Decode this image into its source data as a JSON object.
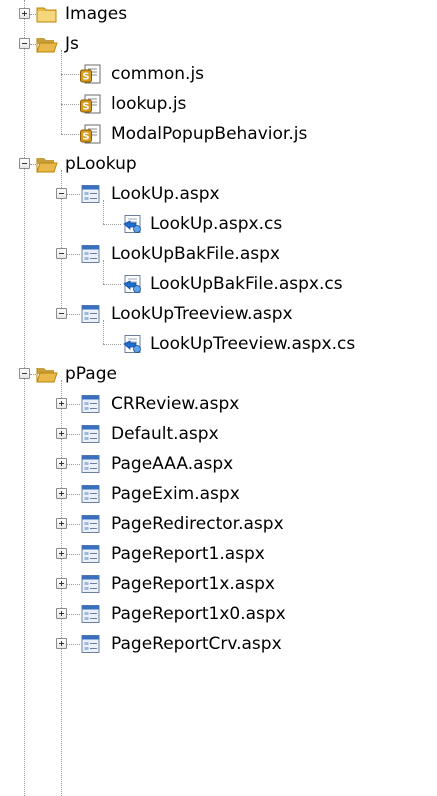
{
  "tree": {
    "rows": [
      {
        "label": "Images",
        "level": 0,
        "icon": "folder-closed",
        "toggle": "plus",
        "last": false
      },
      {
        "label": "Js",
        "level": 0,
        "icon": "folder-open",
        "toggle": "minus",
        "last": false
      },
      {
        "label": "common.js",
        "level": 1,
        "icon": "js-file",
        "toggle": "none",
        "last": false
      },
      {
        "label": "lookup.js",
        "level": 1,
        "icon": "js-file",
        "toggle": "none",
        "last": false
      },
      {
        "label": "ModalPopupBehavior.js",
        "level": 1,
        "icon": "js-file",
        "toggle": "none",
        "last": true
      },
      {
        "label": "pLookup",
        "level": 0,
        "icon": "folder-open",
        "toggle": "minus",
        "last": false
      },
      {
        "label": "LookUp.aspx",
        "level": 1,
        "icon": "aspx-file",
        "toggle": "minus",
        "last": false
      },
      {
        "label": "LookUp.aspx.cs",
        "level": 2,
        "icon": "cs-file",
        "toggle": "none",
        "last": true
      },
      {
        "label": "LookUpBakFile.aspx",
        "level": 1,
        "icon": "aspx-file",
        "toggle": "minus",
        "last": false
      },
      {
        "label": "LookUpBakFile.aspx.cs",
        "level": 2,
        "icon": "cs-file",
        "toggle": "none",
        "last": true
      },
      {
        "label": "LookUpTreeview.aspx",
        "level": 1,
        "icon": "aspx-file",
        "toggle": "minus",
        "last": true
      },
      {
        "label": "LookUpTreeview.aspx.cs",
        "level": 2,
        "icon": "cs-file",
        "toggle": "none",
        "last": true
      },
      {
        "label": "pPage",
        "level": 0,
        "icon": "folder-open",
        "toggle": "minus",
        "last": false
      },
      {
        "label": "CRReview.aspx",
        "level": 1,
        "icon": "aspx-file",
        "toggle": "plus",
        "last": false
      },
      {
        "label": "Default.aspx",
        "level": 1,
        "icon": "aspx-file",
        "toggle": "plus",
        "last": false
      },
      {
        "label": "PageAAA.aspx",
        "level": 1,
        "icon": "aspx-file",
        "toggle": "plus",
        "last": false
      },
      {
        "label": "PageExim.aspx",
        "level": 1,
        "icon": "aspx-file",
        "toggle": "plus",
        "last": false
      },
      {
        "label": "PageRedirector.aspx",
        "level": 1,
        "icon": "aspx-file",
        "toggle": "plus",
        "last": false
      },
      {
        "label": "PageReport1.aspx",
        "level": 1,
        "icon": "aspx-file",
        "toggle": "plus",
        "last": false
      },
      {
        "label": "PageReport1x.aspx",
        "level": 1,
        "icon": "aspx-file",
        "toggle": "plus",
        "last": false
      },
      {
        "label": "PageReport1x0.aspx",
        "level": 1,
        "icon": "aspx-file",
        "toggle": "plus",
        "last": false
      },
      {
        "label": "PageReportCrv.aspx",
        "level": 1,
        "icon": "aspx-file",
        "toggle": "plus",
        "last": false
      }
    ]
  },
  "colors": {
    "folder": "#e8b84a",
    "folder_dark": "#b8860b",
    "js_badge": "#d89a1c",
    "aspx_blue": "#3a6fc0",
    "cs_blue": "#1f6fd1",
    "tree_line": "#9a9a9a"
  }
}
